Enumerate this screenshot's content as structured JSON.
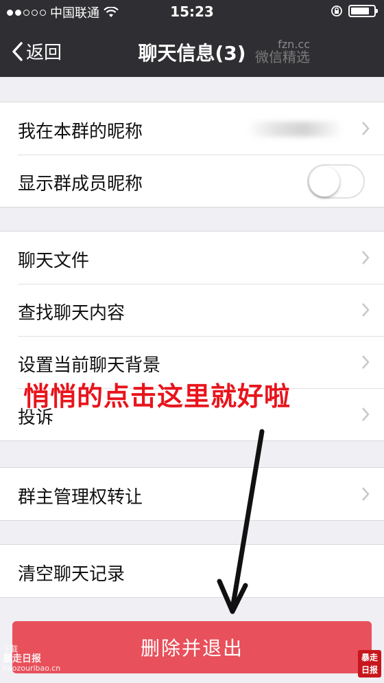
{
  "status_bar": {
    "carrier": "中国联通",
    "time": "15:23",
    "signal_dots_filled": 2,
    "signal_dots_total": 5
  },
  "nav": {
    "back_label": "返回",
    "title": "聊天信息(3)"
  },
  "watermark": {
    "line1": "fzn.cc",
    "line2": "微信精选"
  },
  "groups": [
    {
      "items": [
        {
          "label": "我在本群的昵称",
          "accessory": "chevron",
          "value": ""
        },
        {
          "label": "显示群成员昵称",
          "accessory": "toggle",
          "toggle_on": false
        }
      ]
    },
    {
      "items": [
        {
          "label": "聊天文件",
          "accessory": "chevron"
        },
        {
          "label": "查找聊天内容",
          "accessory": "chevron"
        },
        {
          "label": "设置当前聊天背景",
          "accessory": "chevron"
        },
        {
          "label": "投诉",
          "accessory": "chevron"
        }
      ]
    },
    {
      "items": [
        {
          "label": "群主管理权转让",
          "accessory": "chevron"
        }
      ]
    },
    {
      "items": [
        {
          "label": "清空聊天记录",
          "accessory": "none"
        }
      ]
    }
  ],
  "annotation": {
    "text": "悄悄的点击这里就好啦",
    "color": "#e8141c"
  },
  "delete_button": {
    "label": "删除并退出",
    "color": "#e8505b"
  },
  "corner_marks": {
    "left_line1": "下载",
    "left_line2": "暴走日报",
    "left_line3": "baozouribao.cn",
    "right": "暴走日报"
  },
  "icons": [
    "wifi-icon",
    "rotation-lock-icon",
    "battery-icon",
    "back-chevron-icon",
    "chevron-right-icon",
    "arrow-annotation-icon"
  ]
}
